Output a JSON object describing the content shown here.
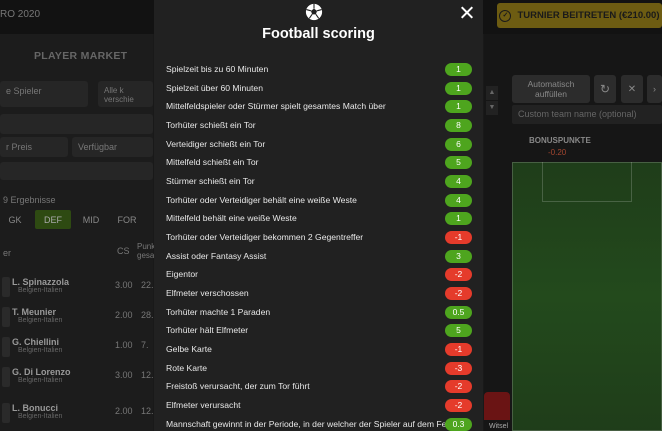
{
  "background": {
    "brand_text": "RO 2020",
    "cta_label": "TURNIER BEITRETEN (€210.00)",
    "cta_icon": "check-circle-icon",
    "player_market_title": "PLAYER MARKET",
    "search_placeholder": "e Spieler",
    "all_clubs_line1": "Alle k",
    "all_clubs_line2": "verschie",
    "sort_label": "r Preis",
    "availability_label": "Verfügbar",
    "results_label": "9 Ergebnisse",
    "position_filters": [
      "GK",
      "DEF",
      "MID",
      "FOR"
    ],
    "active_filter": "DEF",
    "col_player": "er",
    "col_cs": "CS",
    "col_points_line1": "Punk",
    "col_points_line2": "gesam",
    "players": [
      {
        "name": "L. Spinazzola",
        "club": "Belgien-Italien",
        "cs": "3.00",
        "pts": "22."
      },
      {
        "name": "T. Meunier",
        "club": "Belgien-Italien",
        "cs": "2.00",
        "pts": "28."
      },
      {
        "name": "G. Chiellini",
        "club": "Belgien-Italien",
        "cs": "1.00",
        "pts": "7."
      },
      {
        "name": "G. Di Lorenzo",
        "club": "Belgien-Italien",
        "cs": "3.00",
        "pts": "12."
      },
      {
        "name": "L. Bonucci",
        "club": "Belgien-Italien",
        "cs": "2.00",
        "pts": "12."
      }
    ],
    "autofill_label_line1": "Automatisch",
    "autofill_label_line2": "auffüllen",
    "team_name_placeholder": "Custom team name (optional)",
    "bonus_label": "BONUSPUNKTE",
    "bonus_value": "-0.20",
    "jersey_label": "Witsel",
    "colors": {
      "accent_green": "#4ea51e",
      "negative_red": "#e53b2b",
      "cta_gold": "#6d5c12"
    }
  },
  "modal": {
    "icon": "football-icon",
    "title": "Football scoring",
    "close_icon": "close-icon",
    "rules": [
      {
        "text": "Spielzeit bis zu 60 Minuten",
        "points": "1",
        "sign": "pos"
      },
      {
        "text": "Spielzeit über 60 Minuten",
        "points": "1",
        "sign": "pos"
      },
      {
        "text": "Mittelfeldspieler oder Stürmer spielt gesamtes Match über",
        "points": "1",
        "sign": "pos"
      },
      {
        "text": "Torhüter schießt ein Tor",
        "points": "8",
        "sign": "pos"
      },
      {
        "text": "Verteidiger schießt ein Tor",
        "points": "6",
        "sign": "pos"
      },
      {
        "text": "Mittelfeld schießt ein Tor",
        "points": "5",
        "sign": "pos"
      },
      {
        "text": "Stürmer schießt ein Tor",
        "points": "4",
        "sign": "pos"
      },
      {
        "text": "Torhüter oder Verteidiger behält eine weiße Weste",
        "points": "4",
        "sign": "pos"
      },
      {
        "text": "Mittelfeld behält eine weiße Weste",
        "points": "1",
        "sign": "pos"
      },
      {
        "text": "Torhüter oder Verteidiger bekommen 2 Gegentreffer",
        "points": "-1",
        "sign": "neg"
      },
      {
        "text": "Assist oder Fantasy Assist",
        "points": "3",
        "sign": "pos"
      },
      {
        "text": "Eigentor",
        "points": "-2",
        "sign": "neg"
      },
      {
        "text": "Elfmeter verschossen",
        "points": "-2",
        "sign": "neg"
      },
      {
        "text": "Torhüter machte 1 Paraden",
        "points": "0.5",
        "sign": "pos"
      },
      {
        "text": "Torhüter hält Elfmeter",
        "points": "5",
        "sign": "pos"
      },
      {
        "text": "Gelbe Karte",
        "points": "-1",
        "sign": "neg"
      },
      {
        "text": "Rote Karte",
        "points": "-3",
        "sign": "neg"
      },
      {
        "text": "Freistoß verursacht, der zum Tor führt",
        "points": "-2",
        "sign": "neg"
      },
      {
        "text": "Elfmeter verursacht",
        "points": "-2",
        "sign": "neg"
      },
      {
        "text": "Mannschaft gewinnt in der Periode, in der welcher der Spieler auf dem Feld ist",
        "points": "0.3",
        "sign": "pos"
      }
    ]
  }
}
